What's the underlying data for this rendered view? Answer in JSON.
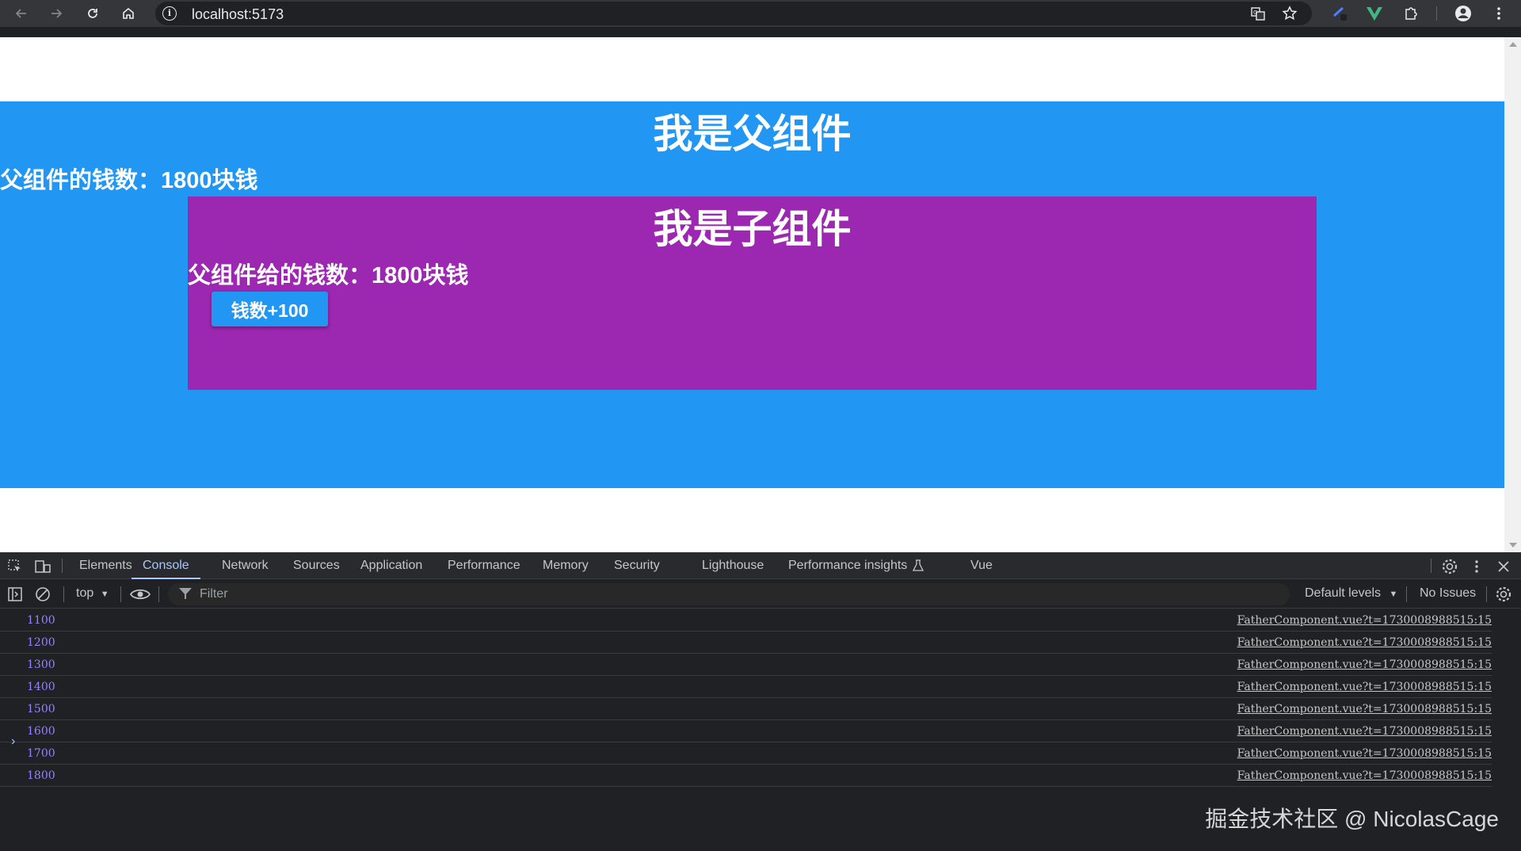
{
  "browser": {
    "url": "localhost:5173",
    "icons": [
      "back-icon",
      "forward-icon",
      "reload-icon",
      "home-icon",
      "site-info-icon",
      "translate-icon",
      "bookmark-star-icon",
      "extension-icon",
      "vue-devtools-icon",
      "extensions-puzzle-icon",
      "profile-icon",
      "menu-icon"
    ]
  },
  "page": {
    "father_title": "我是父组件",
    "father_money": "父组件的钱数：1800块钱",
    "child_title": "我是子组件",
    "child_money": "父组件给的钱数：1800块钱",
    "add_button": "钱数+100",
    "colors": {
      "father_bg": "#2196f3",
      "child_bg": "#9c27b0",
      "button_bg": "#2196f3"
    }
  },
  "devtools": {
    "tabs": [
      "Elements",
      "Console",
      "Network",
      "Sources",
      "Application",
      "Performance",
      "Memory",
      "Security",
      "Lighthouse",
      "Performance insights",
      "Vue"
    ],
    "active_tab": "Console",
    "context": "top",
    "filter_placeholder": "Filter",
    "levels": "Default levels",
    "issues": "No Issues",
    "logs": [
      {
        "value": "1100",
        "source": "FatherComponent.vue?t=1730008988515:15"
      },
      {
        "value": "1200",
        "source": "FatherComponent.vue?t=1730008988515:15"
      },
      {
        "value": "1300",
        "source": "FatherComponent.vue?t=1730008988515:15"
      },
      {
        "value": "1400",
        "source": "FatherComponent.vue?t=1730008988515:15"
      },
      {
        "value": "1500",
        "source": "FatherComponent.vue?t=1730008988515:15"
      },
      {
        "value": "1600",
        "source": "FatherComponent.vue?t=1730008988515:15"
      },
      {
        "value": "1700",
        "source": "FatherComponent.vue?t=1730008988515:15"
      },
      {
        "value": "1800",
        "source": "FatherComponent.vue?t=1730008988515:15"
      }
    ],
    "prompt": "›",
    "watermark": "掘金技术社区 @ NicolasCage"
  }
}
